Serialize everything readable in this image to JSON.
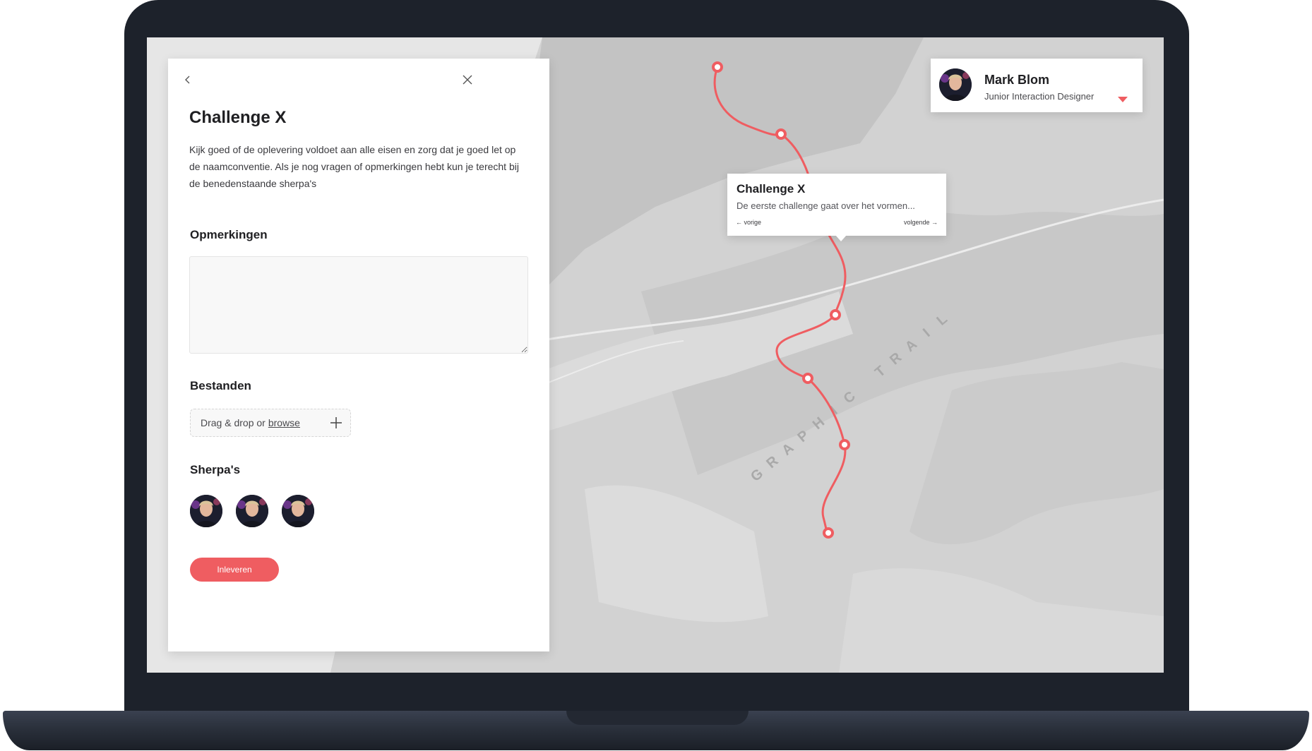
{
  "panel": {
    "title": "Challenge X",
    "description": "Kijk goed of de oplevering voldoet aan alle eisen en zorg dat je goed let op de naamconventie. Als je nog vragen of opmerkingen hebt kun je terecht bij de benedenstaande sherpa's",
    "remarks_heading": "Opmerkingen",
    "remarks_value": "",
    "files_heading": "Bestanden",
    "dropzone_text": "Drag & drop or",
    "browse_label": "browse",
    "sherpas_heading": "Sherpa's",
    "submit_label": "Inleveren"
  },
  "user": {
    "name": "Mark Blom",
    "role": "Junior Interaction Designer"
  },
  "map": {
    "trail_label": "GRAPHIC TRAIL",
    "route_color": "#ef5d61",
    "tooltip": {
      "title": "Challenge X",
      "text": "De eerste challenge gaat over het vormen...",
      "prev_label": "vorige",
      "next_label": "volgende"
    }
  }
}
